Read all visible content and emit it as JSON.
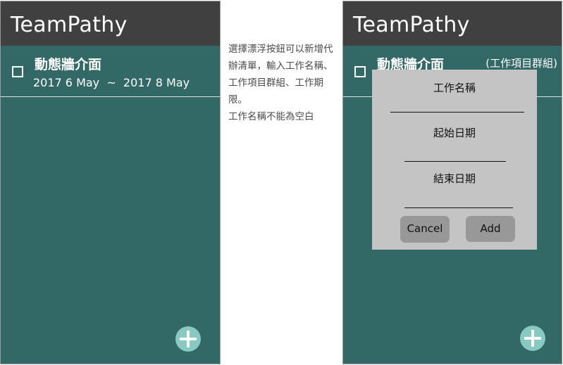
{
  "left_screen": {
    "app_title": "TeamPathy",
    "task": {
      "title": "動態牆介面",
      "dates": "2017 6 May  ~  2017 8 May"
    }
  },
  "description": {
    "lines": [
      "選擇漂浮按鈕可以新增代辦清單，輸入工作名稱、工作項目群組、工作期限。",
      "工作名稱不能為空白"
    ]
  },
  "right_screen": {
    "app_title": "TeamPathy",
    "task": {
      "title": "動態牆介面",
      "group": "(工作項目群組)"
    },
    "dialog": {
      "name_label": "工作名稱",
      "start_label": "起始日期",
      "end_label": "結束日期",
      "cancel_label": "Cancel",
      "add_label": "Add"
    }
  },
  "icons": {
    "checkbox": "checkbox-icon",
    "fab": "plus-icon"
  },
  "colors": {
    "app_bar": "#404040",
    "body": "#326866",
    "fab": "#88c9c2",
    "dialog": "#c4c4c4",
    "dialog_button": "#989898"
  }
}
